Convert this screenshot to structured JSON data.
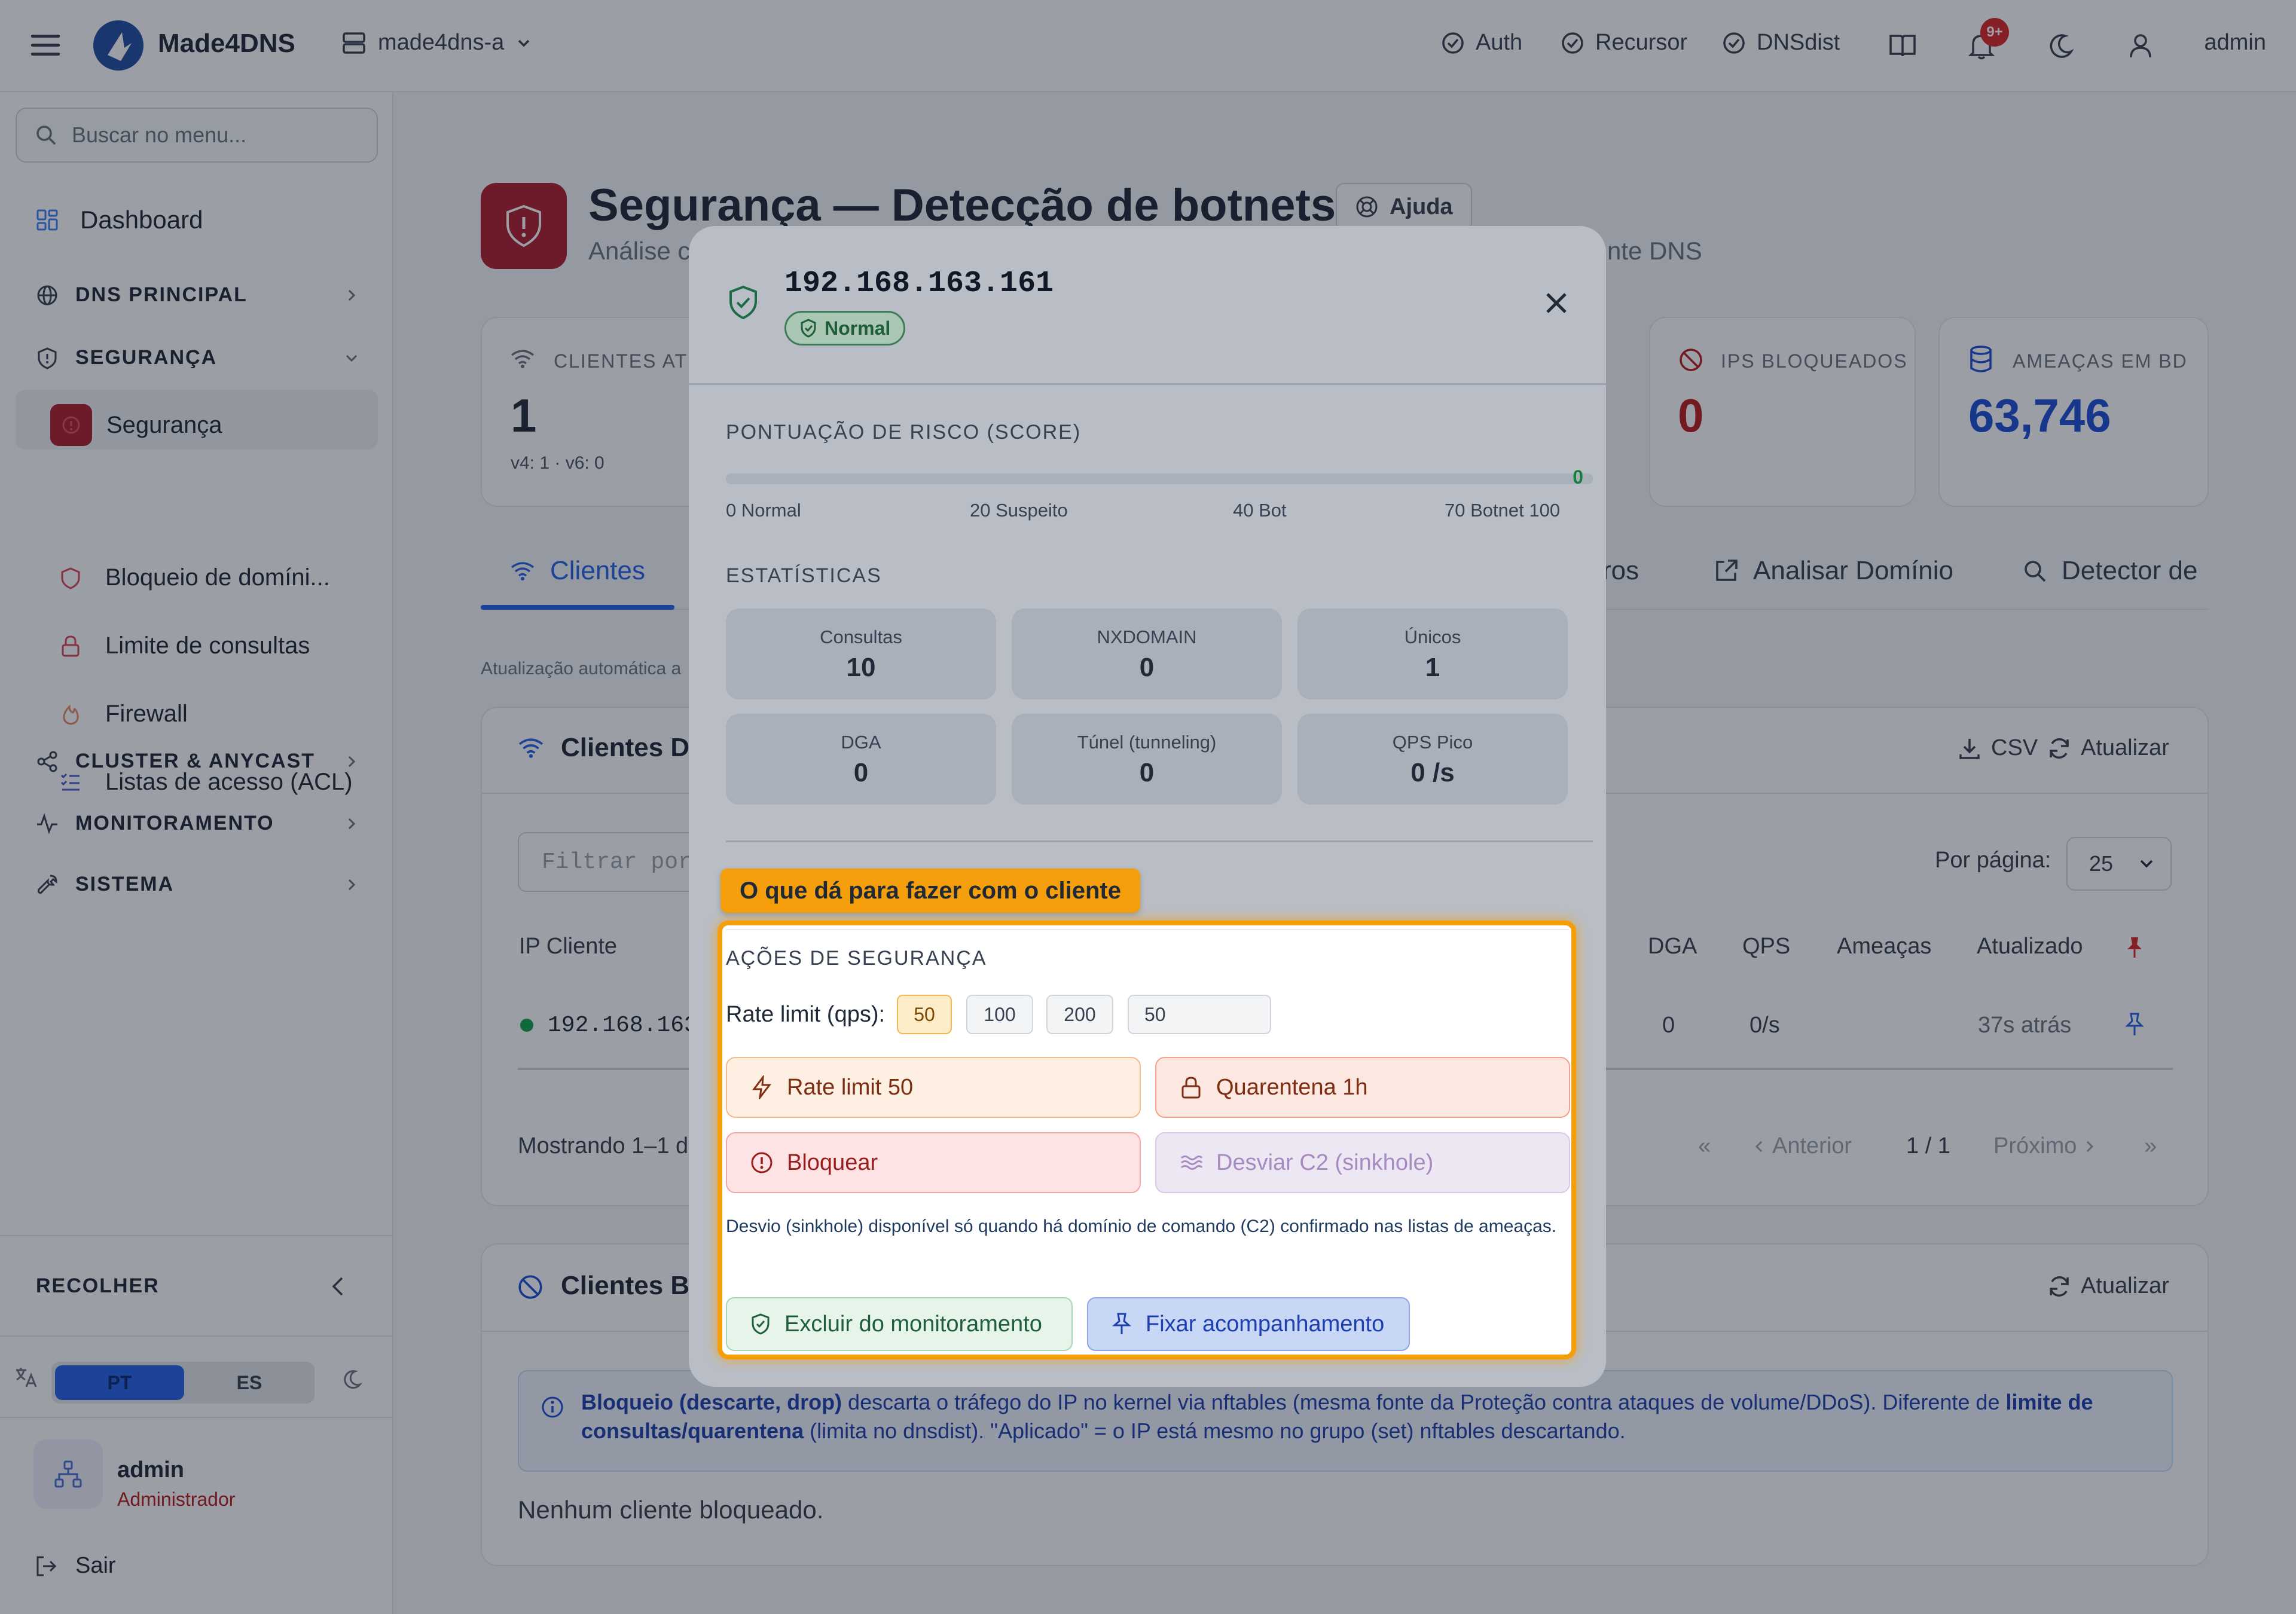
{
  "app": {
    "brand": "Made4DNS",
    "server": "made4dns-a",
    "nav": [
      "Auth",
      "Recursor",
      "DNSdist"
    ],
    "notif_count": "9+",
    "user": "admin"
  },
  "sidebar": {
    "search_placeholder": "Buscar no menu...",
    "dashboard": "Dashboard",
    "sections": {
      "dns": "DNS PRINCIPAL",
      "seg": "SEGURANÇA",
      "cluster": "CLUSTER & ANYCAST",
      "mon": "MONITORAMENTO",
      "sys": "SISTEMA"
    },
    "sub": [
      "Segurança",
      "Bloqueio de domíni...",
      "Limite de consultas",
      "Firewall",
      "Listas de acesso (ACL)"
    ],
    "collapse": "RECOLHER",
    "lang": [
      "PT",
      "ES"
    ],
    "user_name": "admin",
    "user_role": "Administrador",
    "logout": "Sair"
  },
  "main": {
    "title": "Segurança — Detecção de botnets",
    "help": "Ajuda",
    "subtitle_left": "Análise c",
    "subtitle_right": "nte DNS",
    "stats": {
      "clients_label": "CLIENTES ATIV",
      "clients_value": "1",
      "clients_sub": "v4: 1 · v6: 0",
      "blocked_label": "IPS BLOQUEADOS",
      "blocked_value": "0",
      "threats_label": "AMEAÇAS EM BD",
      "threats_value": "63,746"
    },
    "tabs": [
      "Clientes",
      "ros",
      "Analisar Domínio",
      "Detector de"
    ],
    "auto_update": "Atualização automática a",
    "clients_card": {
      "title": "Clientes D",
      "csv": "CSV",
      "refresh": "Atualizar",
      "filter_placeholder": "Filtrar por",
      "per_page_label": "Por página:",
      "per_page_value": "25",
      "headers": [
        "IP Cliente",
        "DGA",
        "QPS",
        "Ameaças",
        "Atualizado"
      ],
      "row": {
        "ip": "192.168.163",
        "dga": "0",
        "qps": "0/s",
        "updated": "37s atrás"
      },
      "showing": "Mostrando 1–1 d",
      "pager": {
        "first": "«",
        "prev": "Anterior",
        "page": "1 / 1",
        "next": "Próximo",
        "last": "»"
      }
    },
    "blocked_card": {
      "title": "Clientes Bl",
      "refresh": "Atualizar",
      "info_b1": "Bloqueio (descarte, drop)",
      "info_t1": " descarta o tráfego do IP no kernel via nftables (mesma fonte da Proteção contra ataques de volume/DDoS). Diferente de ",
      "info_b2": "limite de consultas/quarentena",
      "info_t2": " (limita no dnsdist). \"Aplicado\" = o IP está mesmo no grupo (set) nftables descartando.",
      "empty": "Nenhum cliente bloqueado."
    }
  },
  "modal": {
    "ip": "192.168.163.161",
    "status": "Normal",
    "score_title": "PONTUAÇÃO DE RISCO (SCORE)",
    "score_value": 0,
    "score_display": "0",
    "scale": [
      "0 Normal",
      "20 Suspeito",
      "40 Bot",
      "70 Botnet 100"
    ],
    "stats_title": "ESTATÍSTICAS",
    "stats": [
      {
        "label": "Consultas",
        "value": "10"
      },
      {
        "label": "NXDOMAIN",
        "value": "0"
      },
      {
        "label": "Únicos",
        "value": "1"
      },
      {
        "label": "DGA",
        "value": "0"
      },
      {
        "label": "Túnel (tunneling)",
        "value": "0"
      },
      {
        "label": "QPS Pico",
        "value": "0 /s"
      }
    ],
    "highlight_label": "O que dá para fazer com o cliente",
    "actions_title": "AÇÕES DE SEGURANÇA",
    "rate_label": "Rate limit (qps):",
    "rate_options": [
      "50",
      "100",
      "200"
    ],
    "rate_input": "50",
    "btn_rate": "Rate limit 50",
    "btn_quarantine": "Quarentena 1h",
    "btn_block": "Bloquear",
    "btn_sinkhole": "Desviar C2 (sinkhole)",
    "sinkhole_note": "Desvio (sinkhole) disponível só quando há domínio de comando (C2) confirmado nas listas de ameaças.",
    "btn_exclude": "Excluir do monitoramento",
    "btn_pin": "Fixar acompanhamento"
  }
}
